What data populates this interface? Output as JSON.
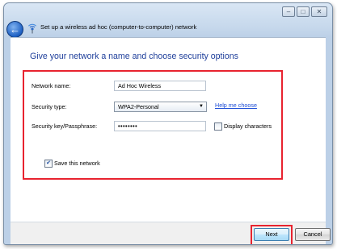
{
  "window": {
    "title": "Set up a wireless ad hoc (computer-to-computer) network",
    "controls": {
      "minimize": "–",
      "maximize": "□",
      "close": "✕"
    },
    "back_icon": "back-arrow-icon",
    "wizard_icon": "wireless-network-icon"
  },
  "page": {
    "heading": "Give your network a name and choose security options"
  },
  "form": {
    "network_name_label": "Network name:",
    "network_name_value": "Ad Hoc Wireless",
    "security_type_label": "Security type:",
    "security_type_value": "WPA2-Personal",
    "help_link": "Help me choose",
    "security_key_label": "Security key/Passphrase:",
    "security_key_value": "••••••••",
    "display_characters_label": "Display characters",
    "display_characters_checked": false,
    "save_network_label": "Save this network",
    "save_network_checked": true
  },
  "footer": {
    "next_label": "Next",
    "cancel_label": "Cancel"
  },
  "colors": {
    "heading": "#1f3f9b",
    "highlight": "#e8232f",
    "link": "#1a4bd6"
  }
}
